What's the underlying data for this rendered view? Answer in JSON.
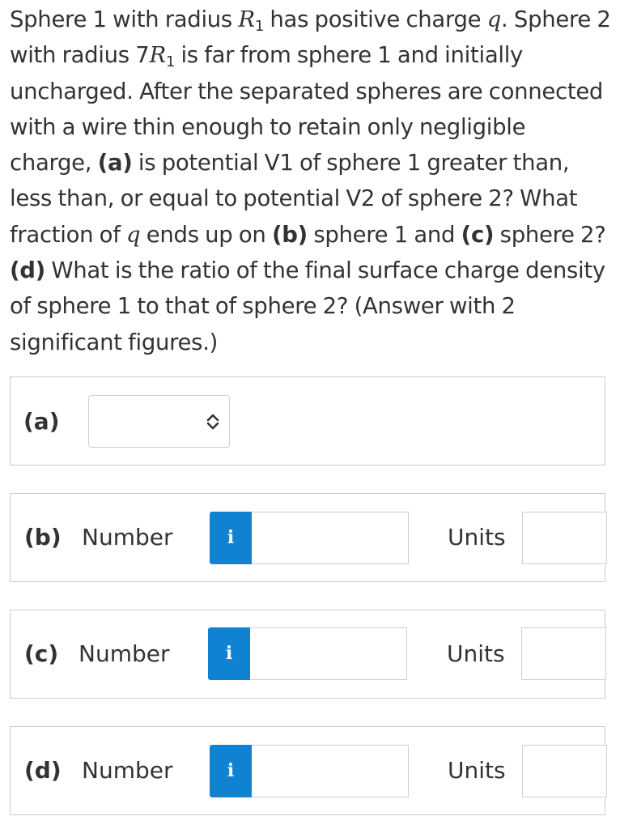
{
  "question": {
    "s1": "Sphere 1 with radius ",
    "r1_letter": "R",
    "r1_sub": "1",
    "s2": " has positive charge ",
    "q1": "q",
    "s3": ". Sphere 2 with radius 7",
    "r2_letter": "R",
    "r2_sub": "1",
    "s4": " is far from sphere 1 and initially uncharged. After the separated spheres are connected with a wire thin enough to retain only negligible charge, ",
    "tag_a": "(a)",
    "s5": " is potential V1 of sphere 1 greater than, less than, or equal to potential V2 of sphere 2? What fraction of ",
    "q2": "q",
    "s6": " ends up on ",
    "tag_b": "(b)",
    "s7": " sphere 1 and ",
    "tag_c": "(c)",
    "s8": " sphere 2? ",
    "tag_d": "(d)",
    "s9": " What is the ratio of the final surface charge density of sphere 1 to that of sphere 2? (Answer with 2 significant figures.)"
  },
  "part_a": {
    "label": "(a)",
    "selected_value": ""
  },
  "part_b": {
    "label": "(b)",
    "number_label": "Number",
    "info_icon": "i",
    "value": "",
    "units_label": "Units",
    "units_value": ""
  },
  "part_c": {
    "label": "(c)",
    "number_label": "Number",
    "info_icon": "i",
    "value": "",
    "units_label": "Units",
    "units_value": ""
  },
  "part_d": {
    "label": "(d)",
    "number_label": "Number",
    "info_icon": "i",
    "value": "",
    "units_label": "Units",
    "units_value": ""
  },
  "colors": {
    "info_button": "#0f82d2",
    "text": "#333333",
    "border": "#cccccc"
  }
}
